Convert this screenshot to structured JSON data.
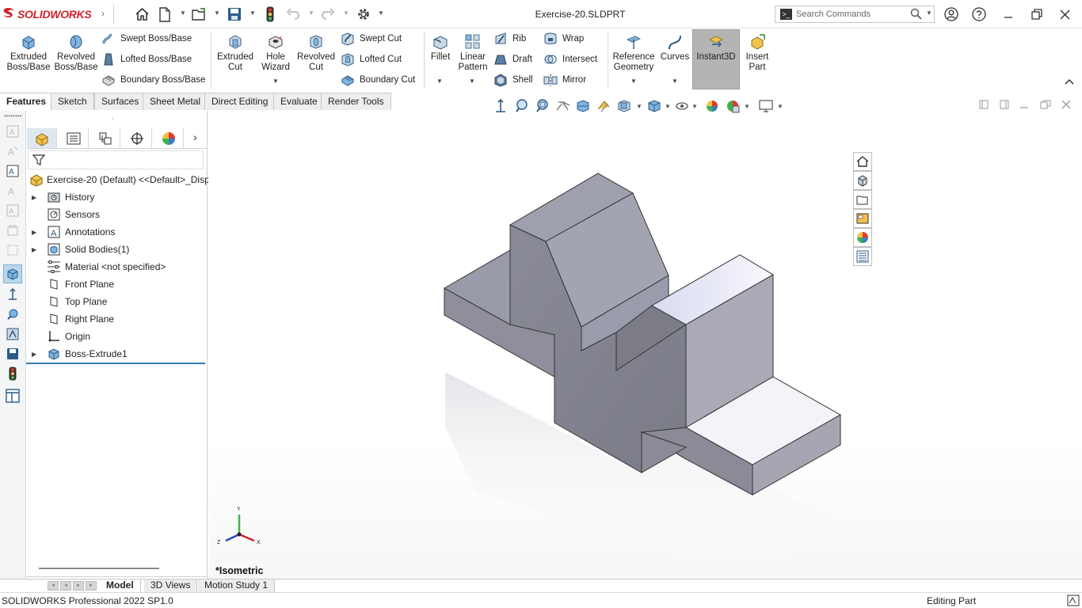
{
  "app": {
    "brand": "SOLIDWORKS",
    "document_title": "Exercise-20.SLDPRT",
    "search_placeholder": "Search Commands"
  },
  "ribbon": {
    "extruded_boss": [
      "Extruded",
      "Boss/Base"
    ],
    "revolved_boss": [
      "Revolved",
      "Boss/Base"
    ],
    "swept_boss": "Swept Boss/Base",
    "lofted_boss": "Lofted Boss/Base",
    "boundary_boss": "Boundary Boss/Base",
    "extruded_cut": [
      "Extruded",
      "Cut"
    ],
    "hole_wizard": [
      "Hole",
      "Wizard"
    ],
    "revolved_cut": [
      "Revolved",
      "Cut"
    ],
    "swept_cut": "Swept Cut",
    "lofted_cut": "Lofted Cut",
    "boundary_cut": "Boundary Cut",
    "fillet": "Fillet",
    "linear_pattern": [
      "Linear",
      "Pattern"
    ],
    "rib": "Rib",
    "draft": "Draft",
    "shell": "Shell",
    "wrap": "Wrap",
    "intersect": "Intersect",
    "mirror": "Mirror",
    "reference_geometry": [
      "Reference",
      "Geometry"
    ],
    "curves": "Curves",
    "instant3d": "Instant3D",
    "insert_part": [
      "Insert",
      "Part"
    ]
  },
  "command_tabs": [
    "Features",
    "Sketch",
    "Surfaces",
    "Sheet Metal",
    "Direct Editing",
    "Evaluate",
    "Render Tools"
  ],
  "feature_tree": {
    "root": "Exercise-20 (Default) <<Default>_Disp",
    "items": [
      {
        "label": "History",
        "icon": "history-folder-icon",
        "expandable": true
      },
      {
        "label": "Sensors",
        "icon": "sensors-icon",
        "expandable": false
      },
      {
        "label": "Annotations",
        "icon": "annotations-icon",
        "expandable": true
      },
      {
        "label": "Solid Bodies(1)",
        "icon": "solid-bodies-icon",
        "expandable": true
      },
      {
        "label": "Material <not specified>",
        "icon": "material-icon",
        "expandable": false
      },
      {
        "label": "Front Plane",
        "icon": "plane-icon",
        "expandable": false
      },
      {
        "label": "Top Plane",
        "icon": "plane-icon",
        "expandable": false
      },
      {
        "label": "Right Plane",
        "icon": "plane-icon",
        "expandable": false
      },
      {
        "label": "Origin",
        "icon": "origin-icon",
        "expandable": false
      },
      {
        "label": "Boss-Extrude1",
        "icon": "extrude-feature-icon",
        "expandable": true
      }
    ]
  },
  "viewport": {
    "view_label": "*Isometric",
    "triad": {
      "x": "X",
      "y": "Y",
      "z": "Z"
    }
  },
  "bottom_tabs": [
    "Model",
    "3D Views",
    "Motion Study 1"
  ],
  "status": {
    "product": "SOLIDWORKS Professional 2022 SP1.0",
    "mode": "Editing Part"
  },
  "colors": {
    "brand_red": "#d2232a",
    "model_gray": "#8e8f98",
    "selection_blue": "#2d7fb8"
  }
}
